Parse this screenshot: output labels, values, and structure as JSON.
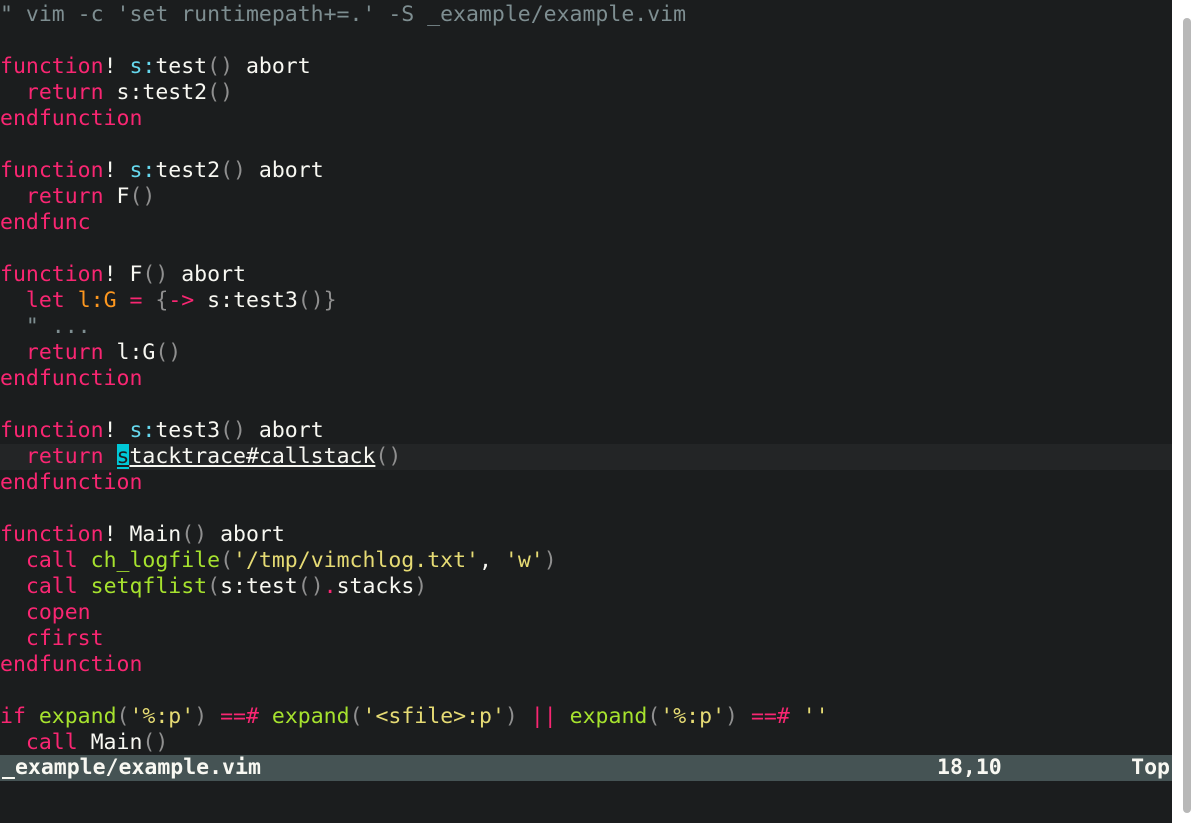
{
  "editor": {
    "lines": [
      [
        {
          "c": "t-comment",
          "t": "\" vim -c 'set runtimepath+=.' -S _example/example.vim"
        }
      ],
      [],
      [
        {
          "c": "t-keyword",
          "t": "function"
        },
        {
          "c": "t-bang",
          "t": "! "
        },
        {
          "c": "t-scope",
          "t": "s:"
        },
        {
          "c": "t-plain",
          "t": "test"
        },
        {
          "c": "t-paren",
          "t": "()"
        },
        {
          "c": "t-plain",
          "t": " abort"
        }
      ],
      [
        {
          "c": "t-plain",
          "t": "  "
        },
        {
          "c": "t-keyword",
          "t": "return"
        },
        {
          "c": "t-plain",
          "t": " s:test2"
        },
        {
          "c": "t-paren",
          "t": "()"
        }
      ],
      [
        {
          "c": "t-keyword",
          "t": "endfunction"
        }
      ],
      [],
      [
        {
          "c": "t-keyword",
          "t": "function"
        },
        {
          "c": "t-bang",
          "t": "! "
        },
        {
          "c": "t-scope",
          "t": "s:"
        },
        {
          "c": "t-plain",
          "t": "test2"
        },
        {
          "c": "t-paren",
          "t": "()"
        },
        {
          "c": "t-plain",
          "t": " abort"
        }
      ],
      [
        {
          "c": "t-plain",
          "t": "  "
        },
        {
          "c": "t-keyword",
          "t": "return"
        },
        {
          "c": "t-plain",
          "t": " F"
        },
        {
          "c": "t-paren",
          "t": "()"
        }
      ],
      [
        {
          "c": "t-keyword",
          "t": "endfunc"
        }
      ],
      [],
      [
        {
          "c": "t-keyword",
          "t": "function"
        },
        {
          "c": "t-bang",
          "t": "! "
        },
        {
          "c": "t-plain",
          "t": "F"
        },
        {
          "c": "t-paren",
          "t": "()"
        },
        {
          "c": "t-plain",
          "t": " abort"
        }
      ],
      [
        {
          "c": "t-plain",
          "t": "  "
        },
        {
          "c": "t-keyword",
          "t": "let"
        },
        {
          "c": "t-plain",
          "t": " "
        },
        {
          "c": "t-var",
          "t": "l:G"
        },
        {
          "c": "t-plain",
          "t": " "
        },
        {
          "c": "t-op",
          "t": "="
        },
        {
          "c": "t-plain",
          "t": " "
        },
        {
          "c": "t-paren",
          "t": "{"
        },
        {
          "c": "t-op",
          "t": "->"
        },
        {
          "c": "t-plain",
          "t": " s:test3"
        },
        {
          "c": "t-paren",
          "t": "()}"
        }
      ],
      [
        {
          "c": "t-comment",
          "t": "  \" ..."
        }
      ],
      [
        {
          "c": "t-plain",
          "t": "  "
        },
        {
          "c": "t-keyword",
          "t": "return"
        },
        {
          "c": "t-plain",
          "t": " l:G"
        },
        {
          "c": "t-paren",
          "t": "()"
        }
      ],
      [
        {
          "c": "t-keyword",
          "t": "endfunction"
        }
      ],
      [],
      [
        {
          "c": "t-keyword",
          "t": "function"
        },
        {
          "c": "t-bang",
          "t": "! "
        },
        {
          "c": "t-scope",
          "t": "s:"
        },
        {
          "c": "t-plain",
          "t": "test3"
        },
        {
          "c": "t-paren",
          "t": "()"
        },
        {
          "c": "t-plain",
          "t": " abort"
        }
      ],
      [
        {
          "c": "t-plain",
          "t": "  "
        },
        {
          "c": "t-keyword",
          "t": "return"
        },
        {
          "c": "t-plain",
          "t": " "
        },
        {
          "c": "cursor",
          "t": "s"
        },
        {
          "c": "t-underline",
          "t": "tacktrace#callstack"
        },
        {
          "c": "t-paren",
          "t": "()"
        }
      ],
      [
        {
          "c": "t-keyword",
          "t": "endfunction"
        }
      ],
      [],
      [
        {
          "c": "t-keyword",
          "t": "function"
        },
        {
          "c": "t-bang",
          "t": "! "
        },
        {
          "c": "t-plain",
          "t": "Main"
        },
        {
          "c": "t-paren",
          "t": "()"
        },
        {
          "c": "t-plain",
          "t": " abort"
        }
      ],
      [
        {
          "c": "t-plain",
          "t": "  "
        },
        {
          "c": "t-keyword",
          "t": "call"
        },
        {
          "c": "t-plain",
          "t": " "
        },
        {
          "c": "t-builtin",
          "t": "ch_logfile"
        },
        {
          "c": "t-paren",
          "t": "("
        },
        {
          "c": "t-string",
          "t": "'/tmp/vimchlog.txt'"
        },
        {
          "c": "t-plain",
          "t": ", "
        },
        {
          "c": "t-string",
          "t": "'w'"
        },
        {
          "c": "t-paren",
          "t": ")"
        }
      ],
      [
        {
          "c": "t-plain",
          "t": "  "
        },
        {
          "c": "t-keyword",
          "t": "call"
        },
        {
          "c": "t-plain",
          "t": " "
        },
        {
          "c": "t-builtin",
          "t": "setqflist"
        },
        {
          "c": "t-paren",
          "t": "("
        },
        {
          "c": "t-plain",
          "t": "s:test"
        },
        {
          "c": "t-paren",
          "t": "()"
        },
        {
          "c": "t-op",
          "t": "."
        },
        {
          "c": "t-plain",
          "t": "stacks"
        },
        {
          "c": "t-paren",
          "t": ")"
        }
      ],
      [
        {
          "c": "t-plain",
          "t": "  "
        },
        {
          "c": "t-keyword",
          "t": "copen"
        }
      ],
      [
        {
          "c": "t-plain",
          "t": "  "
        },
        {
          "c": "t-keyword",
          "t": "cfirst"
        }
      ],
      [
        {
          "c": "t-keyword",
          "t": "endfunction"
        }
      ],
      [],
      [
        {
          "c": "t-keyword",
          "t": "if"
        },
        {
          "c": "t-plain",
          "t": " "
        },
        {
          "c": "t-builtin",
          "t": "expand"
        },
        {
          "c": "t-paren",
          "t": "("
        },
        {
          "c": "t-string",
          "t": "'%:p'"
        },
        {
          "c": "t-paren",
          "t": ")"
        },
        {
          "c": "t-plain",
          "t": " "
        },
        {
          "c": "t-op",
          "t": "==#"
        },
        {
          "c": "t-plain",
          "t": " "
        },
        {
          "c": "t-builtin",
          "t": "expand"
        },
        {
          "c": "t-paren",
          "t": "("
        },
        {
          "c": "t-string",
          "t": "'<sfile>:p'"
        },
        {
          "c": "t-paren",
          "t": ")"
        },
        {
          "c": "t-plain",
          "t": " "
        },
        {
          "c": "t-op",
          "t": "||"
        },
        {
          "c": "t-plain",
          "t": " "
        },
        {
          "c": "t-builtin",
          "t": "expand"
        },
        {
          "c": "t-paren",
          "t": "("
        },
        {
          "c": "t-string",
          "t": "'%:p'"
        },
        {
          "c": "t-paren",
          "t": ")"
        },
        {
          "c": "t-plain",
          "t": " "
        },
        {
          "c": "t-op",
          "t": "==#"
        },
        {
          "c": "t-plain",
          "t": " "
        },
        {
          "c": "t-string",
          "t": "''"
        }
      ],
      [
        {
          "c": "t-plain",
          "t": "  "
        },
        {
          "c": "t-keyword",
          "t": "call"
        },
        {
          "c": "t-plain",
          "t": " Main"
        },
        {
          "c": "t-paren",
          "t": "()"
        }
      ]
    ],
    "cursor_line_index": 17
  },
  "statusline": {
    "filename": "_example/example.vim",
    "position": "18,10",
    "scroll": "Top"
  },
  "colors": {
    "background": "#1b1d1e",
    "keyword": "#f92672",
    "scope": "#66d9ef",
    "string": "#e6db74",
    "builtin": "#a6e22e",
    "variable": "#fd971f",
    "comment": "#7e8e91",
    "cursor": "#00c8d7",
    "statusline_bg": "#455354"
  }
}
